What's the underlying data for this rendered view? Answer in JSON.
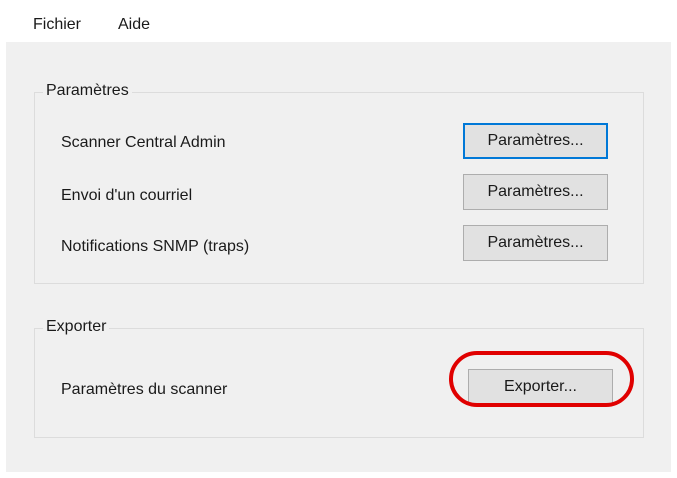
{
  "menu": {
    "file_label": "Fichier",
    "help_label": "Aide"
  },
  "settings_group": {
    "title": "Paramètres",
    "rows": [
      {
        "label": "Scanner Central Admin",
        "button_label": "Paramètres..."
      },
      {
        "label": "Envoi d'un courriel",
        "button_label": "Paramètres..."
      },
      {
        "label": "Notifications SNMP (traps)",
        "button_label": "Paramètres..."
      }
    ]
  },
  "export_group": {
    "title": "Exporter",
    "rows": [
      {
        "label": "Paramètres du scanner",
        "button_label": "Exporter..."
      }
    ]
  },
  "colors": {
    "window_bg": "#f0f0f0",
    "focus_border": "#0078d7",
    "highlight_ring": "#e00000"
  }
}
